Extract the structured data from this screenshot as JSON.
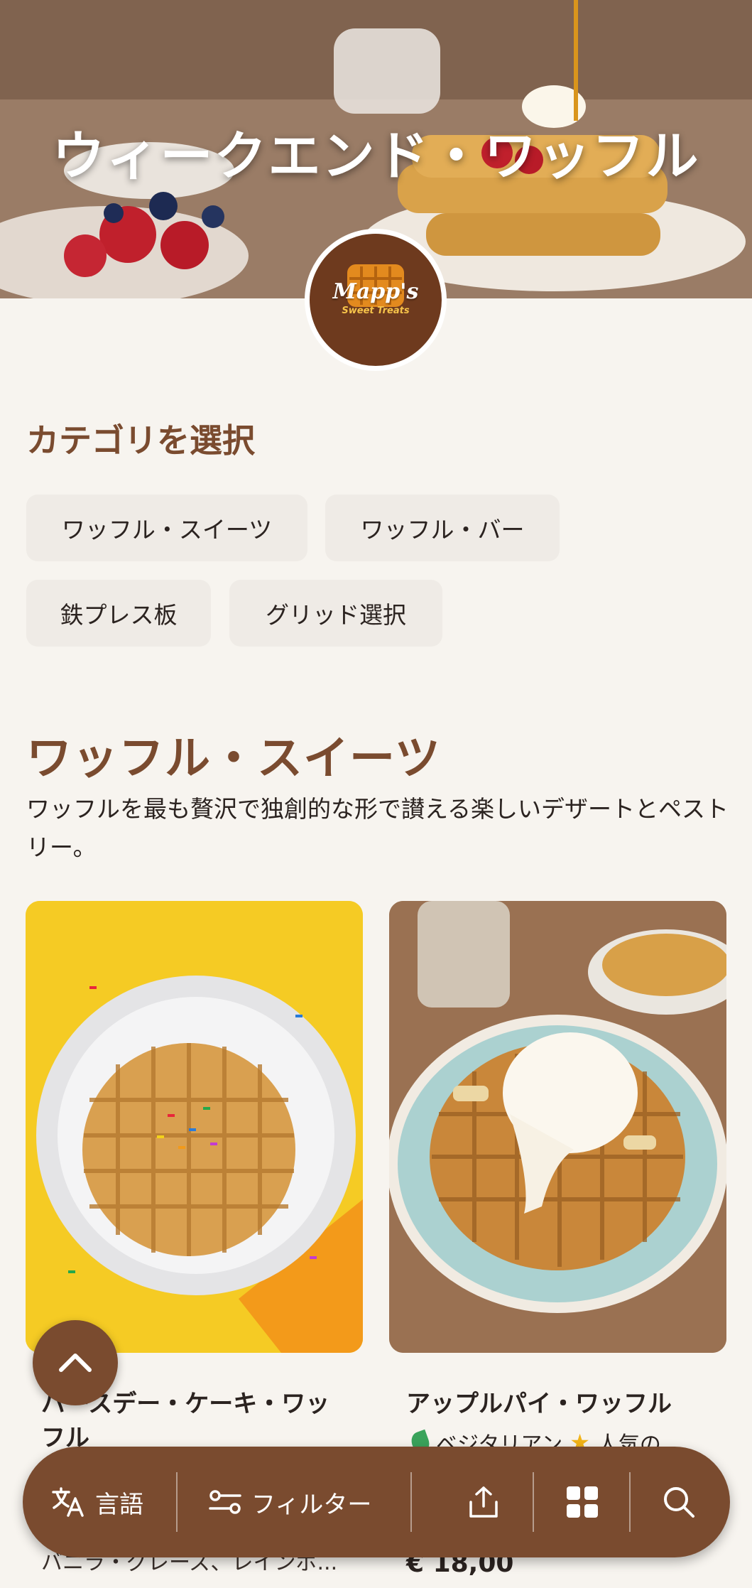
{
  "hero": {
    "title": "ウィークエンド・ワッフル",
    "logo_text": "Mapp's",
    "logo_subtext": "Sweet Treats"
  },
  "categories": {
    "heading": "カテゴリを選択",
    "items": [
      "ワッフル・スイーツ",
      "ワッフル・バー",
      "鉄プレス板",
      "グリッド選択"
    ]
  },
  "section": {
    "title": "ワッフル・スイーツ",
    "description": "ワッフルを最も贅沢で独創的な形で讃える楽しいデザートとペストリー。"
  },
  "products": [
    {
      "name": "バースデー・ケーキ・ワッフル",
      "description": "バニラ・グレーズ、レインボ..."
    },
    {
      "name": "アップルパイ・ワッフル",
      "tags": [
        "ベジタリアン",
        "人気の"
      ],
      "price": "€ 18,00"
    }
  ],
  "bottom_bar": {
    "language_label": "言語",
    "filter_label": "フィルター"
  },
  "colors": {
    "brand_brown": "#7a4b2f",
    "background": "#f7f4ef",
    "chip_bg": "#efebe6"
  },
  "icons": [
    "translate-icon",
    "filter-icon",
    "share-icon",
    "grid-icon",
    "search-icon",
    "chevron-up-icon",
    "leaf-icon",
    "star-icon"
  ]
}
